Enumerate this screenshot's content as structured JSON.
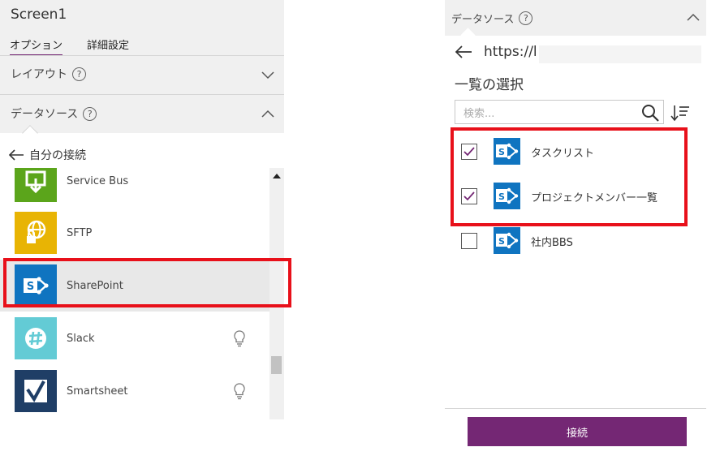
{
  "left_panel": {
    "screen_name": "Screen1",
    "tabs": [
      {
        "label": "オプション",
        "active": true
      },
      {
        "label": "詳細設定",
        "active": false
      }
    ],
    "layout_section": {
      "label": "レイアウト",
      "help": "?"
    },
    "datasource_section": {
      "label": "データソース",
      "help": "?"
    },
    "back_label": "自分の接続",
    "connections": [
      {
        "label": "Service Bus",
        "icon": "service-bus-icon",
        "color": "#5ba51b"
      },
      {
        "label": "SFTP",
        "icon": "sftp-globe-icon",
        "color": "#e8b404"
      },
      {
        "label": "SharePoint",
        "icon": "sharepoint-icon",
        "color": "#0f74c0",
        "highlighted": true
      },
      {
        "label": "Slack",
        "icon": "slack-icon",
        "color": "#63cbd5",
        "premium_icon": "lightbulb-icon"
      },
      {
        "label": "Smartsheet",
        "icon": "smartsheet-icon",
        "color": "#1f3e66",
        "premium_icon": "lightbulb-icon"
      }
    ]
  },
  "right_panel": {
    "header_label": "データソース",
    "help": "?",
    "url_text": "https://l",
    "list_title": "一覧の選択",
    "search_placeholder": "検索...",
    "lists": [
      {
        "label": "タスクリスト",
        "checked": true
      },
      {
        "label": "プロジェクトメンバー一覧",
        "checked": true
      },
      {
        "label": "社内BBS",
        "checked": false
      }
    ],
    "connect_label": "接続"
  },
  "colors": {
    "accent": "#742774",
    "highlight_box": "#e8101a",
    "sharepoint": "#0f74c0"
  }
}
